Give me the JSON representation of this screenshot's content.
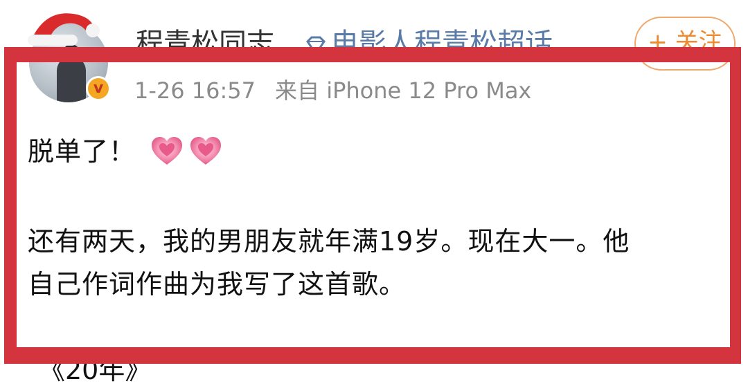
{
  "user": {
    "name": "程青松同志",
    "topic_label": "电影人程青松超话",
    "follow_label": "+ 关注",
    "verified_glyph": "v"
  },
  "post": {
    "timestamp": "1-26 16:57",
    "source": "来自 iPhone 12 Pro Max",
    "line1": "脱单了！",
    "line2": "还有两天，我的男朋友就年满19岁。现在大一。他",
    "line3": "自己作词作曲为我写了这首歌。",
    "song_title": "《20年》",
    "emoji": [
      "heart-icon",
      "heart-icon"
    ]
  },
  "colors": {
    "highlight_frame": "#d4343d",
    "topic_link": "#5a7ba8",
    "follow_accent": "#f08a2e",
    "meta_text": "#8a8a8a",
    "heart_pink": "#f06292"
  }
}
